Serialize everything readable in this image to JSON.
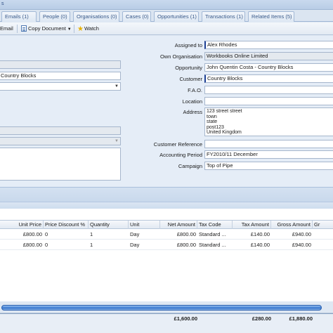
{
  "topstrip": {
    "crumb": "s"
  },
  "tabs": [
    {
      "label": "Emails (1)"
    },
    {
      "label": "People (0)"
    },
    {
      "label": "Organisations (0)"
    },
    {
      "label": "Cases (0)"
    },
    {
      "label": "Opportunities (1)"
    },
    {
      "label": "Transactions (1)"
    },
    {
      "label": "Related Items (5)"
    }
  ],
  "toolbar": {
    "email_label": "Email",
    "copy_label": "Copy Document",
    "watch_label": "Watch"
  },
  "left_form": {
    "customer_partial": "Country Blocks"
  },
  "right_form": {
    "assigned_to": {
      "label": "Assigned to",
      "value": "Alex Rhodes"
    },
    "own_org": {
      "label": "Own Organisation",
      "value": "Workbooks Online Limited"
    },
    "opportunity": {
      "label": "Opportunity",
      "value": "John Quentin Costa - Country Blocks"
    },
    "customer": {
      "label": "Customer",
      "value": "Country Blocks"
    },
    "fao": {
      "label": "F.A.O.",
      "value": ""
    },
    "location": {
      "label": "Location",
      "value": ""
    },
    "address": {
      "label": "Address",
      "value": "123 street street\ntown\nstate\npost123\nUnited Kingdom"
    },
    "customer_reference": {
      "label": "Customer Reference",
      "value": ""
    },
    "accounting_period": {
      "label": "Accounting Period",
      "value": "FY2010/11 December"
    },
    "campaign": {
      "label": "Campaign",
      "value": "Top of Pipe"
    }
  },
  "grid": {
    "columns": [
      "Unit Price",
      "Price Discount %",
      "Quantity",
      "Unit",
      "Net Amount",
      "Tax Code",
      "Tax Amount",
      "Gross Amount",
      "Gr"
    ],
    "rows": [
      [
        "£800.00",
        "0",
        "1",
        "Day",
        "£800.00",
        "Standard ...",
        "£140.00",
        "£940.00"
      ],
      [
        "£800.00",
        "0",
        "1",
        "Day",
        "£800.00",
        "Standard ...",
        "£140.00",
        "£940.00"
      ]
    ],
    "totals": {
      "net": "£1,600.00",
      "tax": "£280.00",
      "gross": "£1,880.00"
    }
  },
  "colors": {
    "accent": "#1c3f94",
    "scroll": "#3d7fd6"
  }
}
